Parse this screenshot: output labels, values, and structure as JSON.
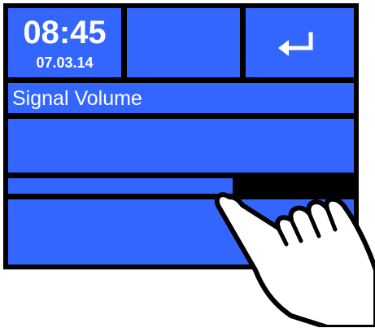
{
  "status": {
    "time": "08:45",
    "date": "07.03.14"
  },
  "header": {
    "enter_icon": "enter-return-icon"
  },
  "page": {
    "title": "Signal Volume"
  },
  "slider": {
    "value_fraction": 0.65
  },
  "overlay": {
    "gesture_icon": "pointing-hand-icon"
  },
  "colors": {
    "panel_blue": "#3366ff",
    "border": "#000000",
    "text": "#ffffff"
  }
}
